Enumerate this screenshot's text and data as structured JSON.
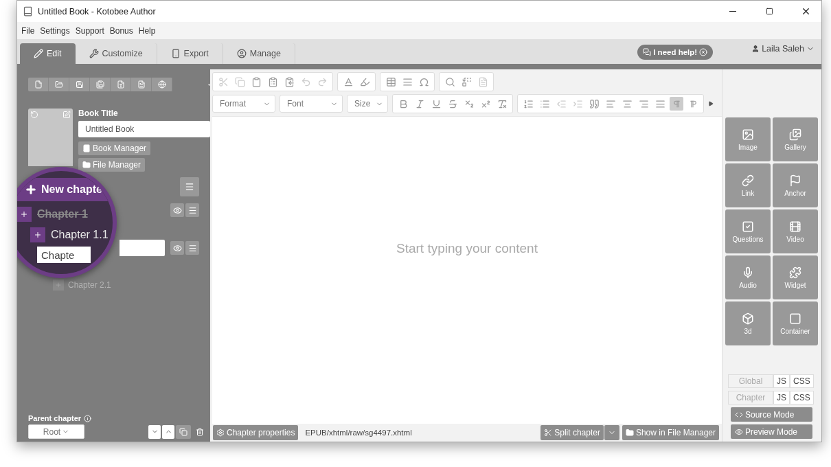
{
  "window": {
    "title": "Untitled Book - Kotobee Author"
  },
  "menu": [
    "File",
    "Settings",
    "Support",
    "Bonus",
    "Help"
  ],
  "tabs": [
    {
      "label": "Edit",
      "selected": true
    },
    {
      "label": "Customize",
      "selected": false
    },
    {
      "label": "Export",
      "selected": false
    },
    {
      "label": "Manage",
      "selected": false
    }
  ],
  "help_button": "I need help!",
  "user": "Laila Saleh",
  "book": {
    "title_label": "Book Title",
    "title_value": "Untitled Book",
    "buttons": [
      "Book Manager",
      "File Manager"
    ]
  },
  "magnifier": {
    "new_chapter": "New chapte",
    "items": [
      {
        "label": "Chapter 1",
        "excluded": true
      },
      {
        "label": "Chapter 1.1",
        "excluded": false
      }
    ],
    "field_value": "Chapte"
  },
  "chapter_below": {
    "label": "Chapter 2.1"
  },
  "parent_chapter": {
    "label": "Parent chapter",
    "value": "Root"
  },
  "editor": {
    "dropdowns": [
      "Format",
      "Font",
      "Size"
    ],
    "direction_buttons": [
      {
        "selected": true
      },
      {
        "selected": false
      }
    ],
    "placeholder": "Start typing your content"
  },
  "status_bar": {
    "properties": "Chapter properties",
    "path": "EPUB/xhtml/raw/sg4497.xhtml",
    "split": "Split chapter",
    "show": "Show in File Manager"
  },
  "widgets": [
    "Image",
    "Gallery",
    "Link",
    "Anchor",
    "Questions",
    "Video",
    "Audio",
    "Widget",
    "3d",
    "Container"
  ],
  "code_rows": [
    {
      "label": "Global",
      "js": "JS",
      "css": "CSS"
    },
    {
      "label": "Chapter",
      "js": "JS",
      "css": "CSS"
    }
  ],
  "modes": [
    "Source Mode",
    "Preview Mode"
  ]
}
